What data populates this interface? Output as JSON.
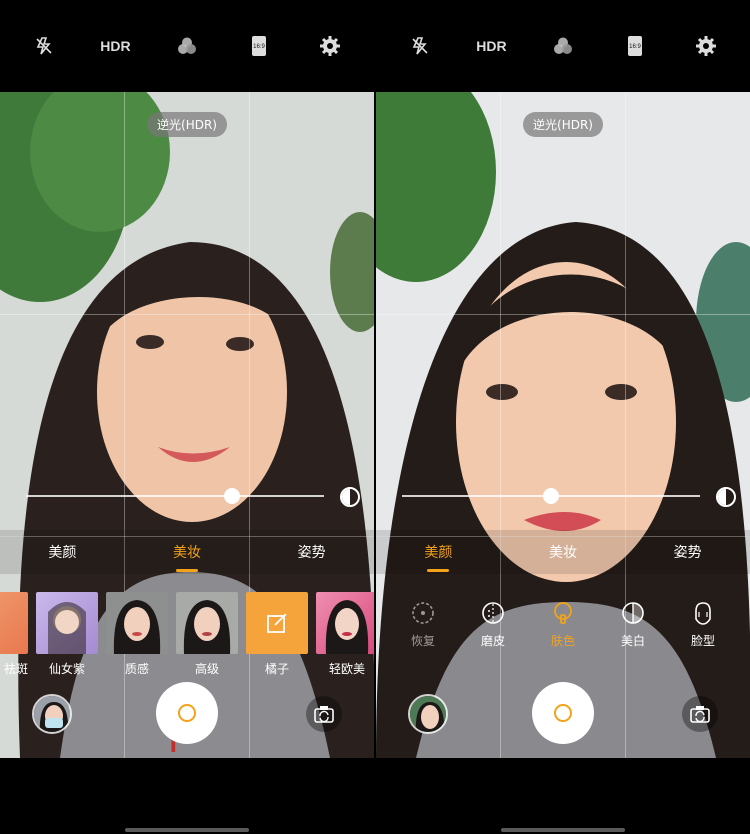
{
  "panes": {
    "left": {
      "topbar": {
        "flash_icon": "flash-off-icon",
        "hdr": "HDR",
        "filter_icon": "color-filter-icon",
        "ratio": "16:9",
        "settings_icon": "gear-icon"
      },
      "scene_mode": "逆光(HDR)",
      "tabs": [
        {
          "label": "美颜",
          "active": false
        },
        {
          "label": "美妆",
          "active": true
        },
        {
          "label": "姿势",
          "active": false
        }
      ],
      "filters": [
        {
          "label": "祛斑",
          "color": "#e9774f"
        },
        {
          "label": "仙女紫",
          "color": "#a58ad1"
        },
        {
          "label": "质感",
          "color": "#c74a48"
        },
        {
          "label": "高级",
          "color": "#b46b60"
        },
        {
          "label": "橘子",
          "color": "#f5a43b"
        },
        {
          "label": "轻欧美",
          "color": "#d7487c"
        }
      ],
      "slider_value": 0.7
    },
    "right": {
      "topbar": {
        "flash_icon": "flash-off-icon",
        "hdr": "HDR",
        "filter_icon": "color-filter-icon",
        "ratio": "16:9",
        "settings_icon": "gear-icon"
      },
      "scene_mode": "逆光(HDR)",
      "tabs": [
        {
          "label": "美颜",
          "active": true
        },
        {
          "label": "美妆",
          "active": false
        },
        {
          "label": "姿势",
          "active": false
        }
      ],
      "tools": [
        {
          "label": "恢复",
          "icon": "reset-icon",
          "state": "dim"
        },
        {
          "label": "磨皮",
          "icon": "smooth-skin-icon",
          "state": "normal"
        },
        {
          "label": "肤色",
          "icon": "skin-tone-icon",
          "state": "active"
        },
        {
          "label": "美白",
          "icon": "whitening-icon",
          "state": "normal"
        },
        {
          "label": "脸型",
          "icon": "face-shape-icon",
          "state": "normal"
        }
      ],
      "slider_value": 0.5
    }
  },
  "colors": {
    "accent": "#f3a21a"
  }
}
